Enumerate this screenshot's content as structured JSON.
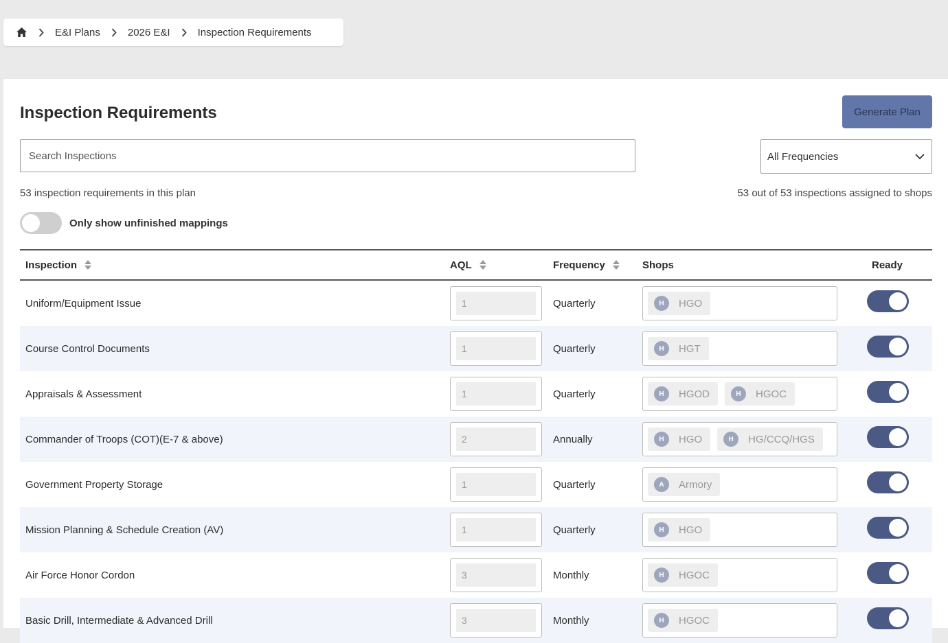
{
  "breadcrumb": {
    "home_icon": "home-icon",
    "items": [
      "E&I Plans",
      "2026 E&I",
      "Inspection Requirements"
    ]
  },
  "page": {
    "title": "Inspection Requirements",
    "generate_label": "Generate Plan",
    "search_placeholder": "Search Inspections",
    "frequency_selected": "All Frequencies",
    "count_left": "53 inspection requirements in this plan",
    "count_right": "53 out of 53 inspections assigned to shops",
    "filter_label": "Only show unfinished mappings",
    "filter_on": false
  },
  "colors": {
    "accent": "#4b5a84",
    "button": "#5a6fa6",
    "row_alt": "#f1f5fb"
  },
  "table": {
    "headers": {
      "inspection": "Inspection",
      "aql": "AQL",
      "frequency": "Frequency",
      "shops": "Shops",
      "ready": "Ready"
    },
    "rows": [
      {
        "name": "Uniform/Equipment Issue",
        "aql": "1",
        "frequency": "Quarterly",
        "shops": [
          {
            "initial": "H",
            "label": "HGO"
          }
        ],
        "ready": true
      },
      {
        "name": "Course Control Documents",
        "aql": "1",
        "frequency": "Quarterly",
        "shops": [
          {
            "initial": "H",
            "label": "HGT"
          }
        ],
        "ready": true
      },
      {
        "name": "Appraisals & Assessment",
        "aql": "1",
        "frequency": "Quarterly",
        "shops": [
          {
            "initial": "H",
            "label": "HGOD"
          },
          {
            "initial": "H",
            "label": "HGOC"
          }
        ],
        "ready": true
      },
      {
        "name": "Commander of Troops (COT)(E-7 & above)",
        "aql": "2",
        "frequency": "Annually",
        "shops": [
          {
            "initial": "H",
            "label": "HGO"
          },
          {
            "initial": "H",
            "label": "HG/CCQ/HGS"
          }
        ],
        "ready": true
      },
      {
        "name": "Government Property Storage",
        "aql": "1",
        "frequency": "Quarterly",
        "shops": [
          {
            "initial": "A",
            "label": "Armory"
          }
        ],
        "ready": true
      },
      {
        "name": "Mission Planning & Schedule Creation (AV)",
        "aql": "1",
        "frequency": "Quarterly",
        "shops": [
          {
            "initial": "H",
            "label": "HGO"
          }
        ],
        "ready": true
      },
      {
        "name": "Air Force Honor Cordon",
        "aql": "3",
        "frequency": "Monthly",
        "shops": [
          {
            "initial": "H",
            "label": "HGOC"
          }
        ],
        "ready": true
      },
      {
        "name": "Basic Drill, Intermediate & Advanced Drill",
        "aql": "3",
        "frequency": "Monthly",
        "shops": [
          {
            "initial": "H",
            "label": "HGOC"
          }
        ],
        "ready": true
      }
    ]
  }
}
